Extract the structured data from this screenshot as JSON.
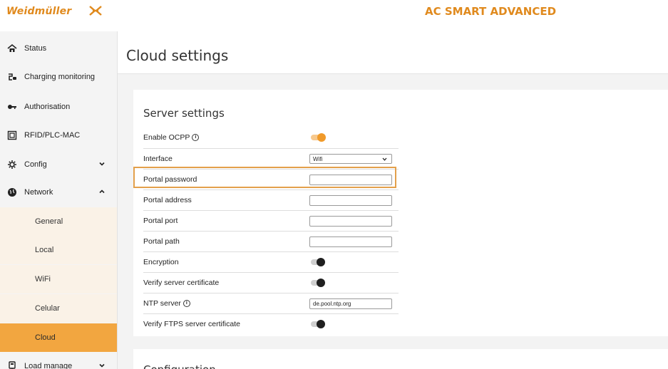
{
  "header": {
    "logo_text": "Weidmüller",
    "product_title": "AC SMART ADVANCED",
    "brand_color": "#e08a1e"
  },
  "sidebar": {
    "items": [
      {
        "label": "Status",
        "icon": "home-icon"
      },
      {
        "label": "Charging monitoring",
        "icon": "charging-plug-icon"
      },
      {
        "label": "Authorisation",
        "icon": "key-icon"
      },
      {
        "label": "RFID/PLC-MAC",
        "icon": "card-reader-icon"
      },
      {
        "label": "Config",
        "icon": "sliders-icon",
        "chevron": "down"
      },
      {
        "label": "Network",
        "icon": "globe-icon",
        "chevron": "up"
      },
      {
        "label": "Load manage",
        "icon": "load-management-icon",
        "chevron": "down"
      }
    ],
    "network_subitems": [
      {
        "label": "General",
        "active": false
      },
      {
        "label": "Local",
        "active": false
      },
      {
        "label": "WiFi",
        "active": false
      },
      {
        "label": "Celular",
        "active": false
      },
      {
        "label": "Cloud",
        "active": true
      }
    ],
    "active_color": "#f2a640",
    "subitem_bg": "#faf2e7"
  },
  "main": {
    "page_title": "Cloud settings",
    "server_settings": {
      "title": "Server settings",
      "rows": [
        {
          "label": "Enable OCPP",
          "info": true,
          "control": "toggle",
          "value": "on"
        },
        {
          "label": "Interface",
          "control": "select",
          "value": "Wifi"
        },
        {
          "label": "Portal password",
          "control": "input",
          "value": "",
          "highlighted": true
        },
        {
          "label": "Portal address",
          "control": "input",
          "value": ""
        },
        {
          "label": "Portal port",
          "control": "input",
          "value": ""
        },
        {
          "label": "Portal path",
          "control": "input",
          "value": ""
        },
        {
          "label": "Encryption",
          "control": "toggle",
          "value": "off"
        },
        {
          "label": "Verify server certificate",
          "control": "toggle",
          "value": "off"
        },
        {
          "label": "NTP server",
          "info": true,
          "control": "input",
          "value": "de.pool.ntp.org"
        },
        {
          "label": "Verify FTPS server certificate",
          "control": "toggle",
          "value": "off"
        }
      ]
    },
    "next_section_title": "Configuration"
  }
}
